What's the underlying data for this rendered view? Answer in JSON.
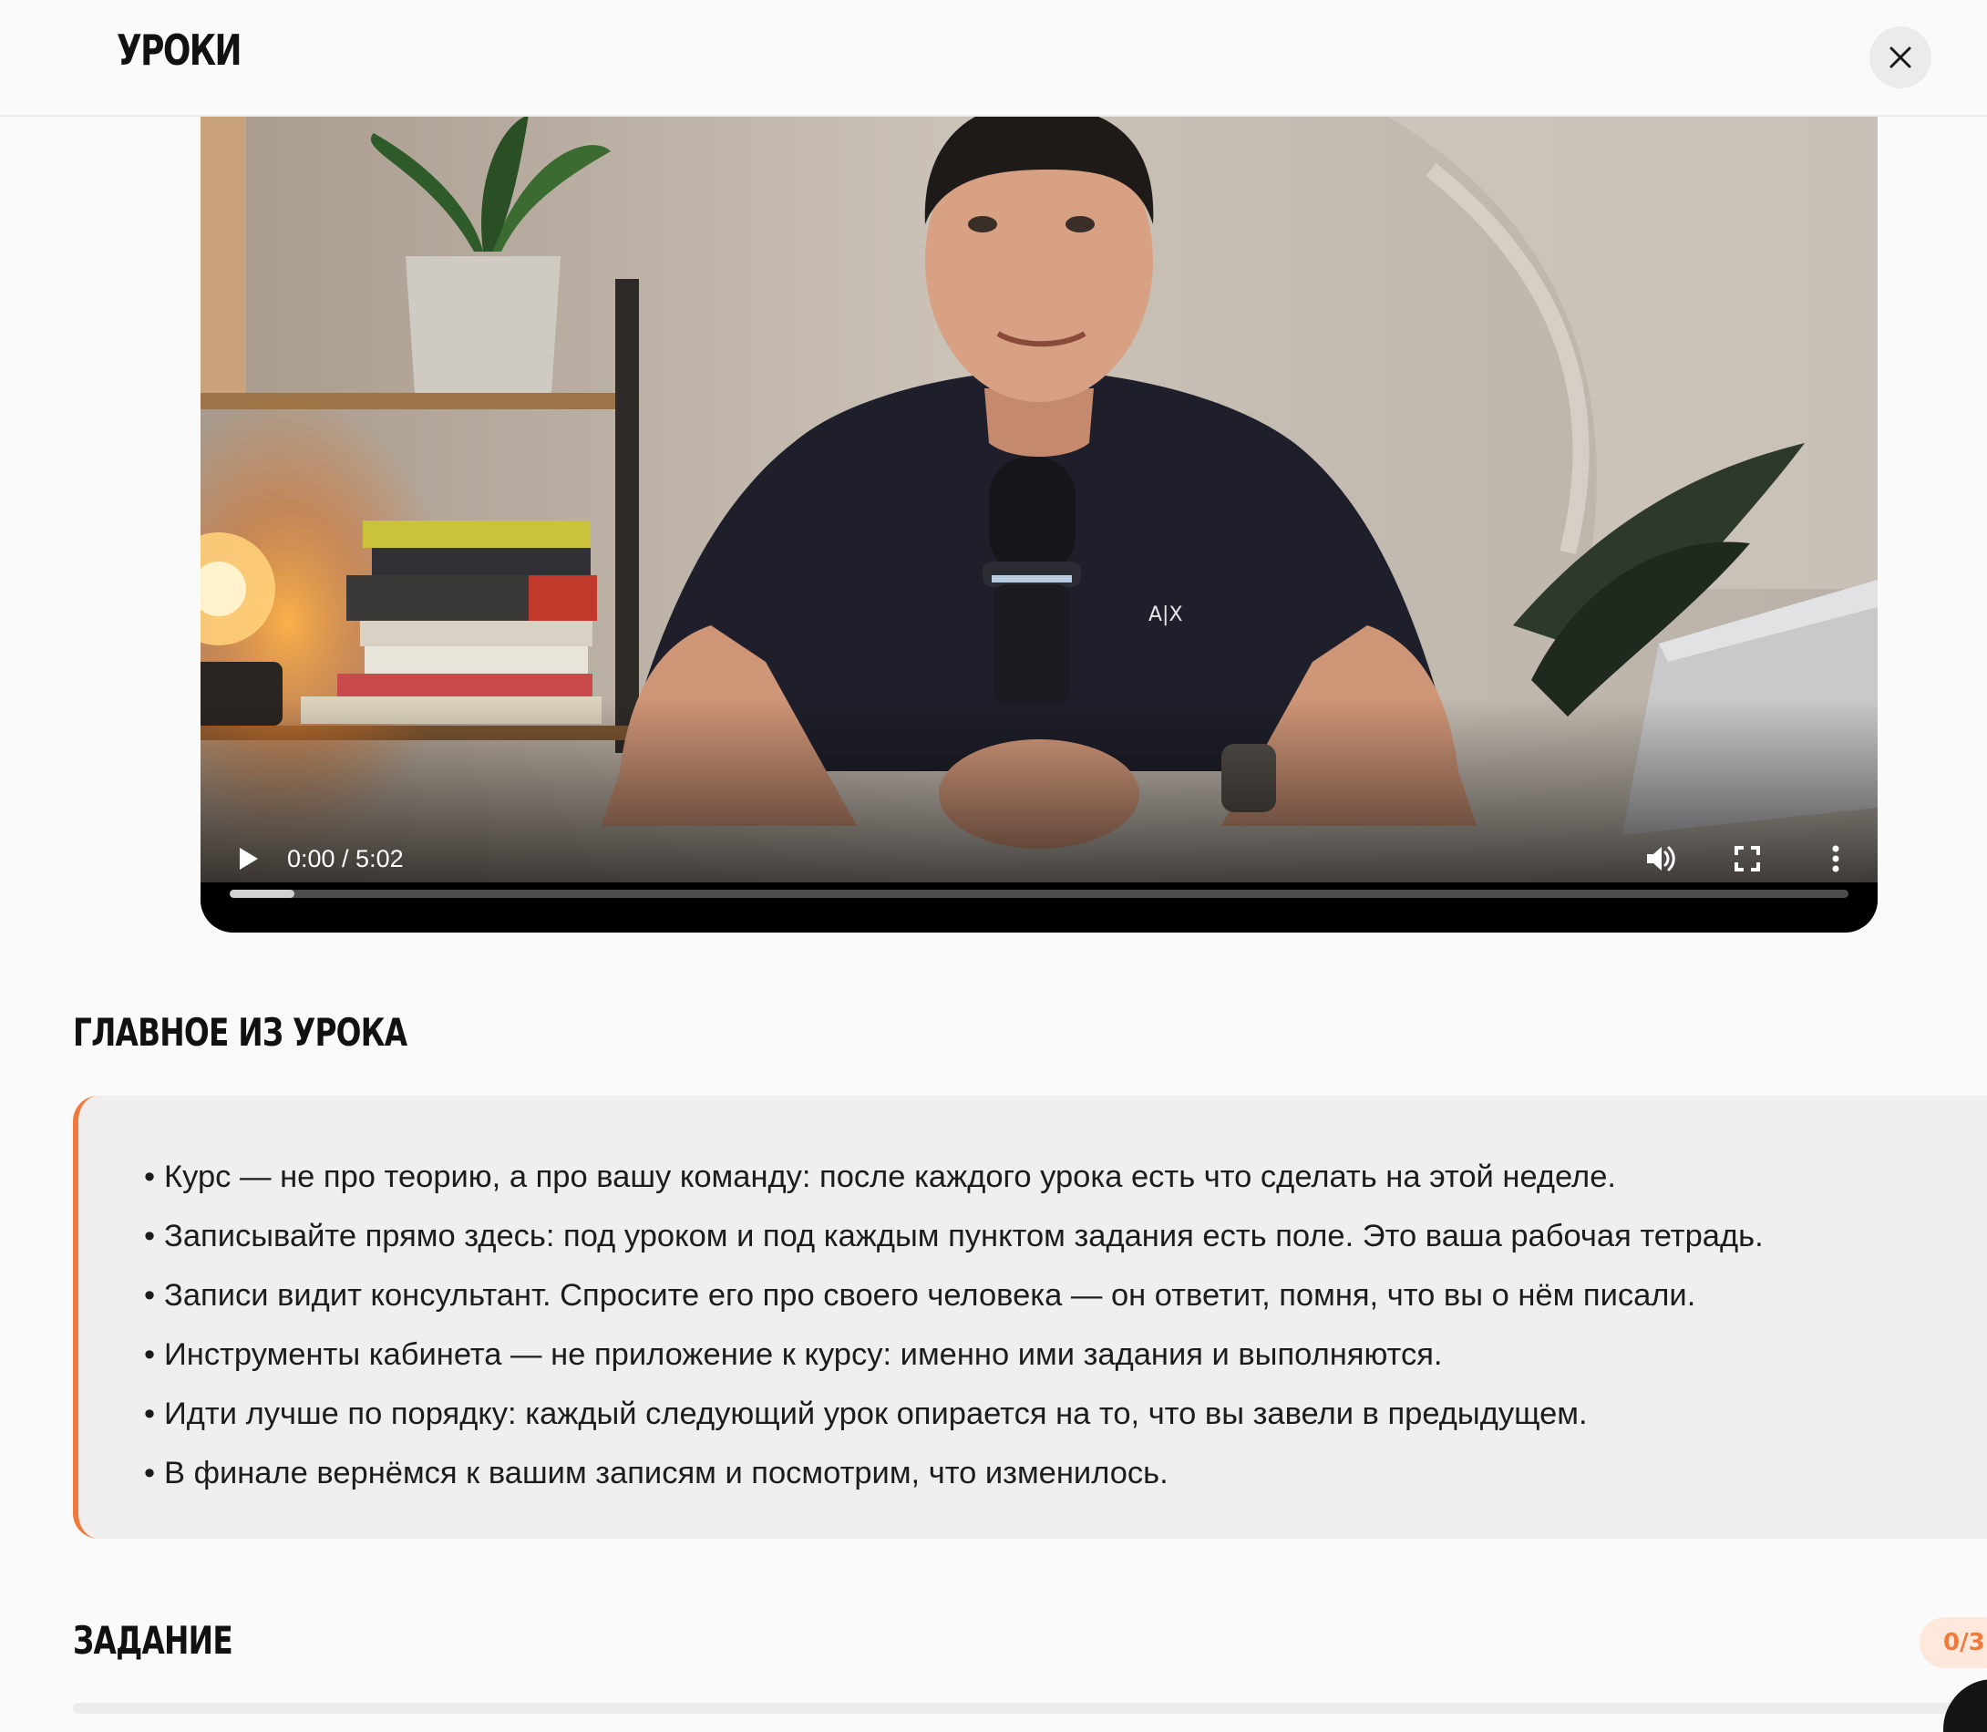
{
  "header": {
    "title": "УРОКИ"
  },
  "video": {
    "time_display": "0:00 / 5:02",
    "progress_fraction": 0.04,
    "icons": [
      "play-icon",
      "volume-icon",
      "fullscreen-icon",
      "more-vert-icon"
    ]
  },
  "summary": {
    "title": "ГЛАВНОЕ ИЗ УРОКА",
    "items": [
      "Курс — не про теорию, а про вашу команду: после каждого урока есть что сделать на этой неделе.",
      "Записывайте прямо здесь: под уроком и под каждым пунктом задания есть поле. Это ваша рабочая тетрадь.",
      "Записи видит консультант. Спросите его про своего человека — он ответит, помня, что вы о нём писали.",
      "Инструменты кабинета — не приложение к курсу: именно ими задания и выполняются.",
      "Идти лучше по порядку: каждый следующий урок опирается на то, что вы завели в предыдущем.",
      "В финале вернёмся к вашим записям и посмотрим, что изменилось."
    ]
  },
  "task": {
    "title": "ЗАДАНИЕ",
    "badge": "0/3"
  },
  "colors": {
    "accent": "#f07a3c",
    "card_bg": "#f0efed",
    "page_bg": "#fafafa"
  }
}
